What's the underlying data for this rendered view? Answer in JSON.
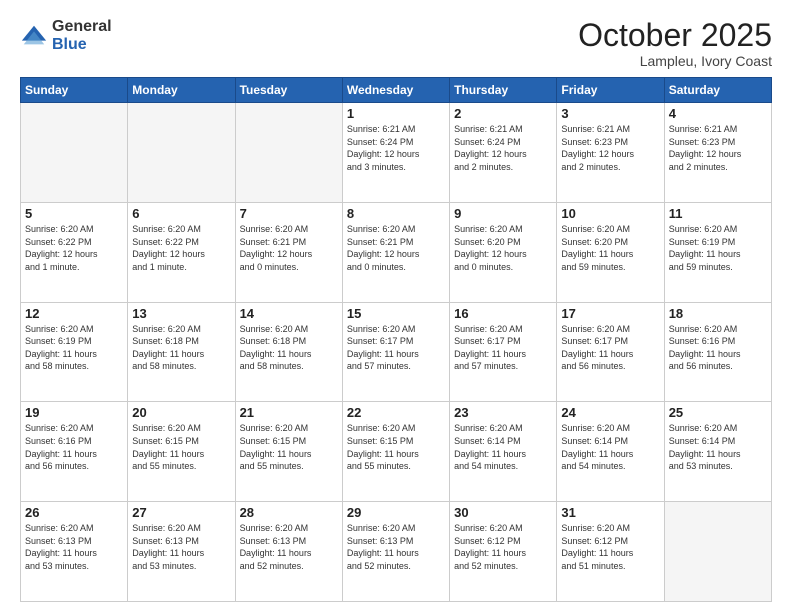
{
  "logo": {
    "general": "General",
    "blue": "Blue"
  },
  "header": {
    "month": "October 2025",
    "location": "Lampleu, Ivory Coast"
  },
  "weekdays": [
    "Sunday",
    "Monday",
    "Tuesday",
    "Wednesday",
    "Thursday",
    "Friday",
    "Saturday"
  ],
  "weeks": [
    [
      {
        "day": "",
        "info": ""
      },
      {
        "day": "",
        "info": ""
      },
      {
        "day": "",
        "info": ""
      },
      {
        "day": "1",
        "info": "Sunrise: 6:21 AM\nSunset: 6:24 PM\nDaylight: 12 hours\nand 3 minutes."
      },
      {
        "day": "2",
        "info": "Sunrise: 6:21 AM\nSunset: 6:24 PM\nDaylight: 12 hours\nand 2 minutes."
      },
      {
        "day": "3",
        "info": "Sunrise: 6:21 AM\nSunset: 6:23 PM\nDaylight: 12 hours\nand 2 minutes."
      },
      {
        "day": "4",
        "info": "Sunrise: 6:21 AM\nSunset: 6:23 PM\nDaylight: 12 hours\nand 2 minutes."
      }
    ],
    [
      {
        "day": "5",
        "info": "Sunrise: 6:20 AM\nSunset: 6:22 PM\nDaylight: 12 hours\nand 1 minute."
      },
      {
        "day": "6",
        "info": "Sunrise: 6:20 AM\nSunset: 6:22 PM\nDaylight: 12 hours\nand 1 minute."
      },
      {
        "day": "7",
        "info": "Sunrise: 6:20 AM\nSunset: 6:21 PM\nDaylight: 12 hours\nand 0 minutes."
      },
      {
        "day": "8",
        "info": "Sunrise: 6:20 AM\nSunset: 6:21 PM\nDaylight: 12 hours\nand 0 minutes."
      },
      {
        "day": "9",
        "info": "Sunrise: 6:20 AM\nSunset: 6:20 PM\nDaylight: 12 hours\nand 0 minutes."
      },
      {
        "day": "10",
        "info": "Sunrise: 6:20 AM\nSunset: 6:20 PM\nDaylight: 11 hours\nand 59 minutes."
      },
      {
        "day": "11",
        "info": "Sunrise: 6:20 AM\nSunset: 6:19 PM\nDaylight: 11 hours\nand 59 minutes."
      }
    ],
    [
      {
        "day": "12",
        "info": "Sunrise: 6:20 AM\nSunset: 6:19 PM\nDaylight: 11 hours\nand 58 minutes."
      },
      {
        "day": "13",
        "info": "Sunrise: 6:20 AM\nSunset: 6:18 PM\nDaylight: 11 hours\nand 58 minutes."
      },
      {
        "day": "14",
        "info": "Sunrise: 6:20 AM\nSunset: 6:18 PM\nDaylight: 11 hours\nand 58 minutes."
      },
      {
        "day": "15",
        "info": "Sunrise: 6:20 AM\nSunset: 6:17 PM\nDaylight: 11 hours\nand 57 minutes."
      },
      {
        "day": "16",
        "info": "Sunrise: 6:20 AM\nSunset: 6:17 PM\nDaylight: 11 hours\nand 57 minutes."
      },
      {
        "day": "17",
        "info": "Sunrise: 6:20 AM\nSunset: 6:17 PM\nDaylight: 11 hours\nand 56 minutes."
      },
      {
        "day": "18",
        "info": "Sunrise: 6:20 AM\nSunset: 6:16 PM\nDaylight: 11 hours\nand 56 minutes."
      }
    ],
    [
      {
        "day": "19",
        "info": "Sunrise: 6:20 AM\nSunset: 6:16 PM\nDaylight: 11 hours\nand 56 minutes."
      },
      {
        "day": "20",
        "info": "Sunrise: 6:20 AM\nSunset: 6:15 PM\nDaylight: 11 hours\nand 55 minutes."
      },
      {
        "day": "21",
        "info": "Sunrise: 6:20 AM\nSunset: 6:15 PM\nDaylight: 11 hours\nand 55 minutes."
      },
      {
        "day": "22",
        "info": "Sunrise: 6:20 AM\nSunset: 6:15 PM\nDaylight: 11 hours\nand 55 minutes."
      },
      {
        "day": "23",
        "info": "Sunrise: 6:20 AM\nSunset: 6:14 PM\nDaylight: 11 hours\nand 54 minutes."
      },
      {
        "day": "24",
        "info": "Sunrise: 6:20 AM\nSunset: 6:14 PM\nDaylight: 11 hours\nand 54 minutes."
      },
      {
        "day": "25",
        "info": "Sunrise: 6:20 AM\nSunset: 6:14 PM\nDaylight: 11 hours\nand 53 minutes."
      }
    ],
    [
      {
        "day": "26",
        "info": "Sunrise: 6:20 AM\nSunset: 6:13 PM\nDaylight: 11 hours\nand 53 minutes."
      },
      {
        "day": "27",
        "info": "Sunrise: 6:20 AM\nSunset: 6:13 PM\nDaylight: 11 hours\nand 53 minutes."
      },
      {
        "day": "28",
        "info": "Sunrise: 6:20 AM\nSunset: 6:13 PM\nDaylight: 11 hours\nand 52 minutes."
      },
      {
        "day": "29",
        "info": "Sunrise: 6:20 AM\nSunset: 6:13 PM\nDaylight: 11 hours\nand 52 minutes."
      },
      {
        "day": "30",
        "info": "Sunrise: 6:20 AM\nSunset: 6:12 PM\nDaylight: 11 hours\nand 52 minutes."
      },
      {
        "day": "31",
        "info": "Sunrise: 6:20 AM\nSunset: 6:12 PM\nDaylight: 11 hours\nand 51 minutes."
      },
      {
        "day": "",
        "info": ""
      }
    ]
  ]
}
